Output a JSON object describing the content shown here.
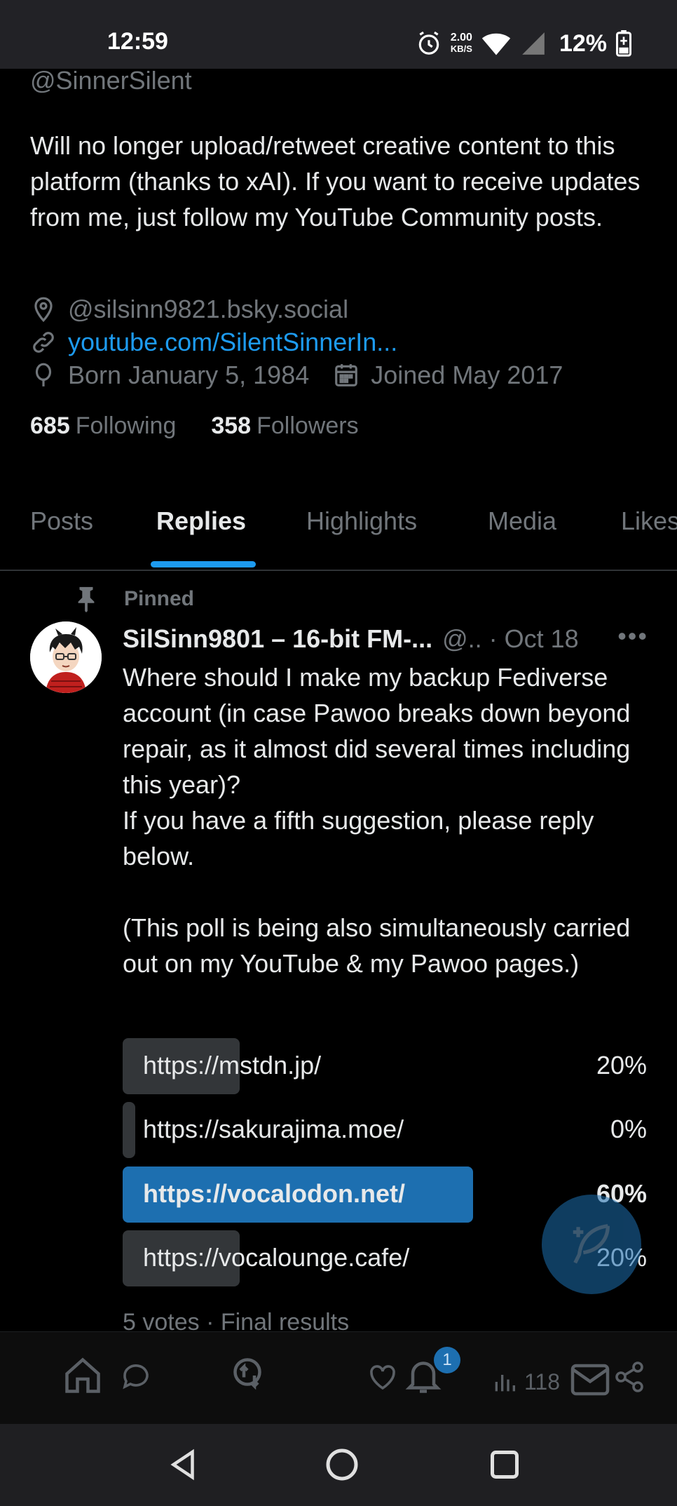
{
  "status_bar": {
    "time": "12:59",
    "speed_value": "2.00",
    "speed_unit": "KB/S",
    "battery": "12%"
  },
  "profile": {
    "handle": "@SinnerSilent",
    "bio": "Will no longer upload/retweet creative content to this platform (thanks to xAI). If you want to receive updates from me, just follow my YouTube Community posts.",
    "location": "@silsinn9821.bsky.social",
    "link": "youtube.com/SilentSinnerIn...",
    "born": "Born January 5, 1984",
    "joined": "Joined May 2017",
    "following_count": "685",
    "following_label": "Following",
    "followers_count": "358",
    "followers_label": "Followers"
  },
  "tabs": [
    "Posts",
    "Replies",
    "Highlights",
    "Media",
    "Likes"
  ],
  "active_tab": "Replies",
  "post": {
    "pinned_label": "Pinned",
    "author_name": "SilSinn9801 – 16-bit FM-...",
    "author_handle_date": "@.. · Oct 18",
    "more": "•••",
    "text": "Where should I make my backup Fediverse account (in case Pawoo breaks down beyond repair, as it almost did several times including this year)?\nIf you have a fifth suggestion, please reply below.\n\n(This poll is being also simultaneously carried out on my YouTube & my Pawoo pages.)",
    "poll": {
      "options": [
        {
          "label": "https://mstdn.jp/",
          "percent": "20%",
          "fraction": 0.2
        },
        {
          "label": "https://sakurajima.moe/",
          "percent": "0%",
          "fraction": 0.0
        },
        {
          "label": "https://vocalodon.net/",
          "percent": "60%",
          "fraction": 0.6
        },
        {
          "label": "https://vocalounge.cafe/",
          "percent": "20%",
          "fraction": 0.2
        }
      ],
      "winner_index": 2,
      "footer": "5 votes · Final results"
    }
  },
  "actions": {
    "notification_badge": "1",
    "views": "118"
  },
  "colors": {
    "accent": "#1d9bf0",
    "poll_winner": "#1d6fb0",
    "poll_bar": "#333639",
    "muted_text": "#71767b"
  }
}
